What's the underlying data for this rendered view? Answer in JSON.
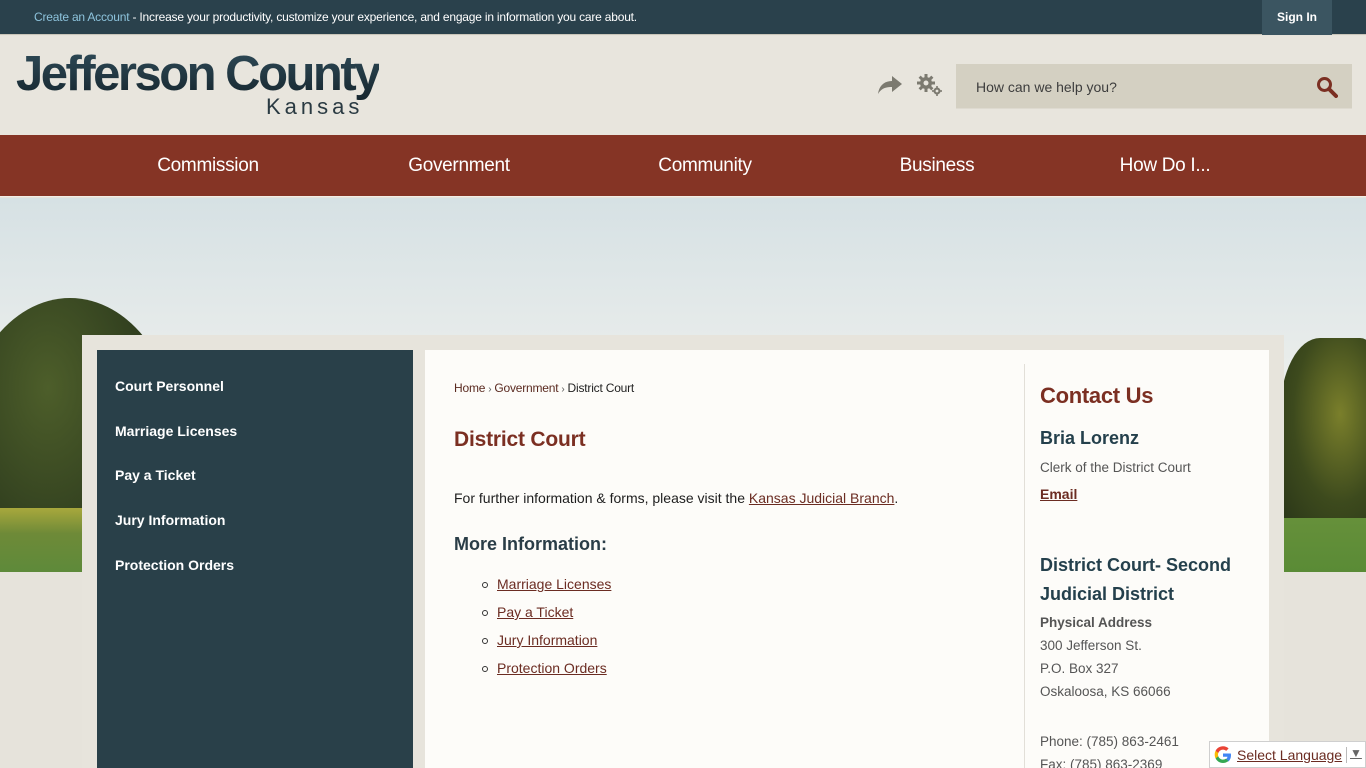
{
  "topbar": {
    "create_account_link": "Create an Account",
    "message": " - Increase your productivity, customize your experience, and engage in information you care about.",
    "sign_in": "Sign In"
  },
  "header": {
    "logo_title": "Jefferson County",
    "logo_subtitle": "Kansas",
    "search_placeholder": "How can we help you?",
    "icons": [
      "share-icon",
      "gear-icon",
      "search-icon"
    ]
  },
  "nav": {
    "items": [
      {
        "label": "Commission"
      },
      {
        "label": "Government"
      },
      {
        "label": "Community"
      },
      {
        "label": "Business"
      },
      {
        "label": "How Do I..."
      }
    ]
  },
  "sidebar": {
    "items": [
      {
        "label": "Court Personnel"
      },
      {
        "label": "Marriage Licenses"
      },
      {
        "label": "Pay a Ticket"
      },
      {
        "label": "Jury Information"
      },
      {
        "label": "Protection Orders"
      }
    ]
  },
  "main": {
    "breadcrumb": [
      {
        "label": "Home"
      },
      {
        "label": "Government"
      },
      {
        "label": "District Court"
      }
    ],
    "breadcrumb_sep": "›",
    "title": "District Court",
    "intro_text": "For further information & forms, please visit the ",
    "intro_link": "Kansas Judicial Branch",
    "intro_end": ".",
    "more_heading": "More Information:",
    "more_links": [
      {
        "label": "Marriage Licenses"
      },
      {
        "label": "Pay a Ticket"
      },
      {
        "label": "Jury Information"
      },
      {
        "label": "Protection Orders"
      }
    ]
  },
  "contact": {
    "heading": "Contact Us",
    "name": "Bria Lorenz",
    "role": "Clerk of the District Court",
    "email_label": "Email",
    "department": "District Court- Second Judicial District",
    "address_heading": "Physical Address",
    "address_lines": [
      "300 Jefferson St.",
      "P.O. Box 327",
      "Oskaloosa, KS 66066"
    ],
    "phone": "Phone: (785) 863-2461",
    "fax": "Fax: (785) 863-2369"
  },
  "translate": {
    "label": "Select Language",
    "arrow": "▼"
  },
  "colors": {
    "topbar": "#2a414c",
    "nav": "#853425",
    "sidebar": "#294049",
    "accent_link": "#6b2c22",
    "title": "#7b2f22",
    "create_account": "#8dc3dc"
  }
}
